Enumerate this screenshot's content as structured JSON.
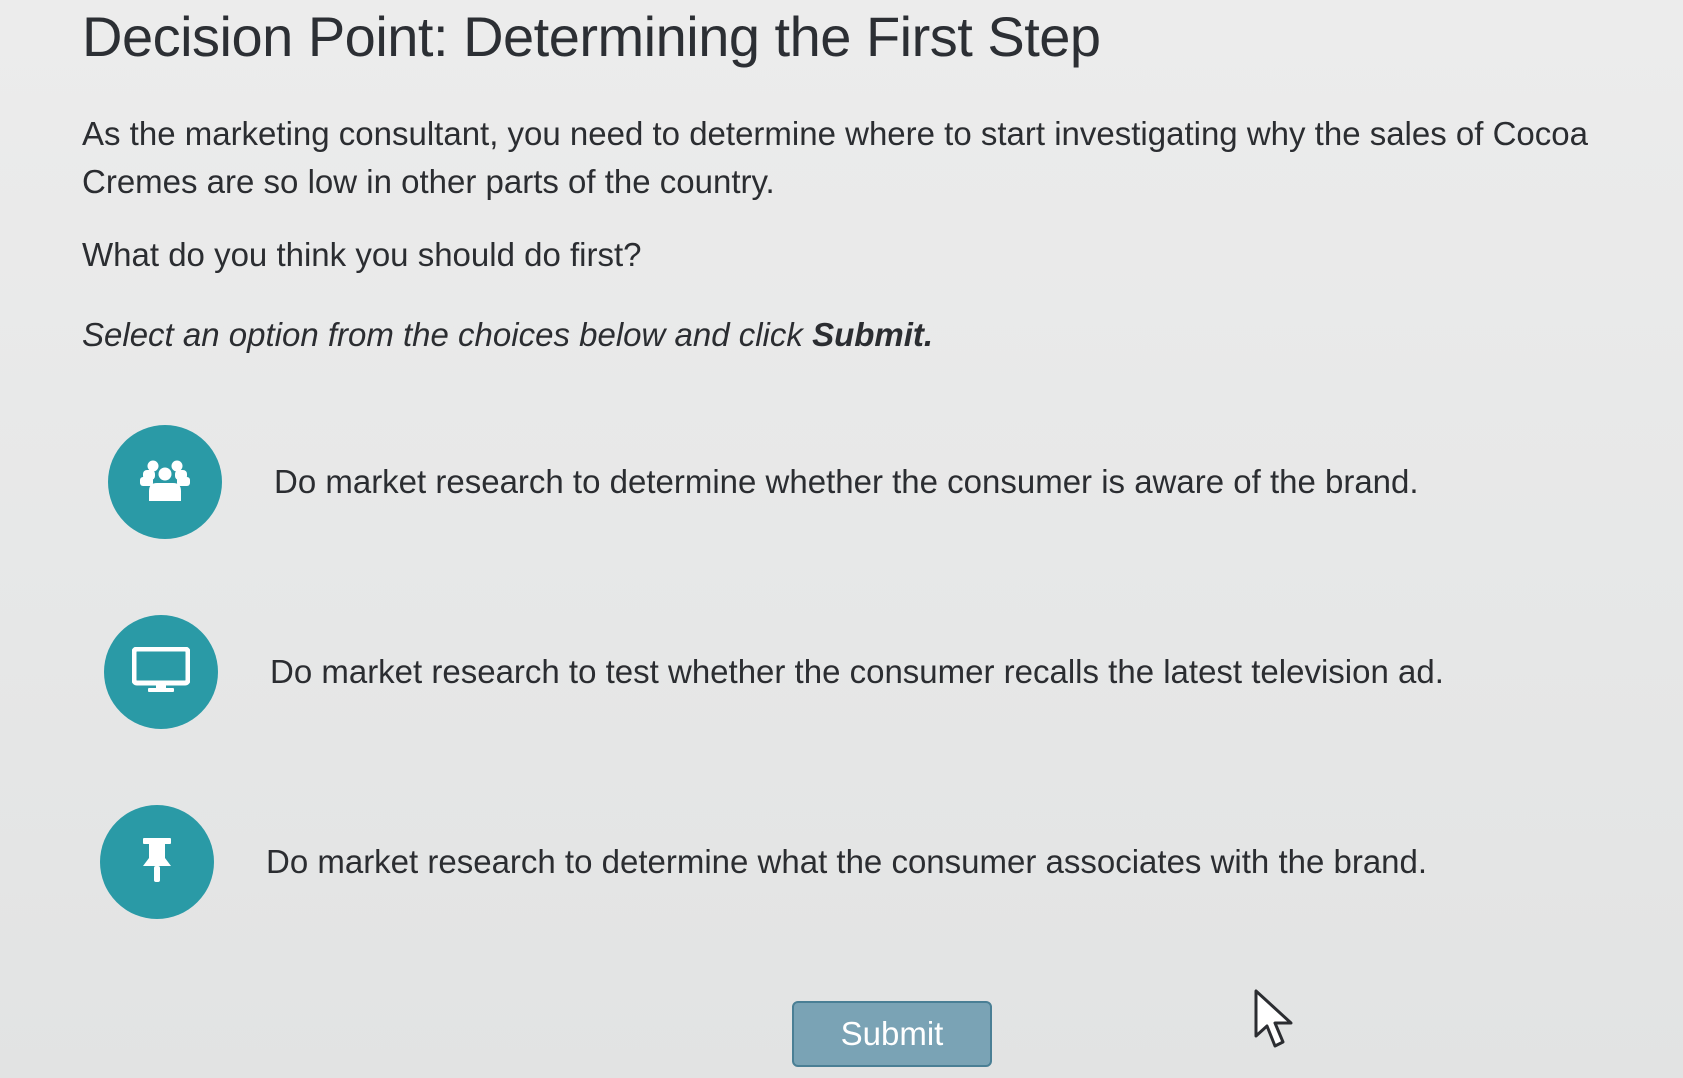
{
  "page": {
    "title": "Decision Point: Determining the First Step",
    "intro": "As the marketing consultant, you need to determine where to start investigating why the sales of Cocoa Cremes are so low in other parts of the country.",
    "question": "What do you think you should do first?",
    "instruction_prefix": "Select an option from the choices below and click ",
    "instruction_bold": "Submit."
  },
  "options": [
    {
      "icon": "group-people-icon",
      "label": "Do market research to determine whether the consumer is aware of the brand."
    },
    {
      "icon": "monitor-icon",
      "label": "Do market research to test whether the consumer recalls the latest television ad."
    },
    {
      "icon": "pushpin-icon",
      "label": "Do market research to determine what the consumer associates with the brand."
    }
  ],
  "submit_label": "Submit",
  "colors": {
    "accent": "#2a9aa6",
    "submit_bg": "#7aa3b5",
    "text": "#2b2d31"
  }
}
